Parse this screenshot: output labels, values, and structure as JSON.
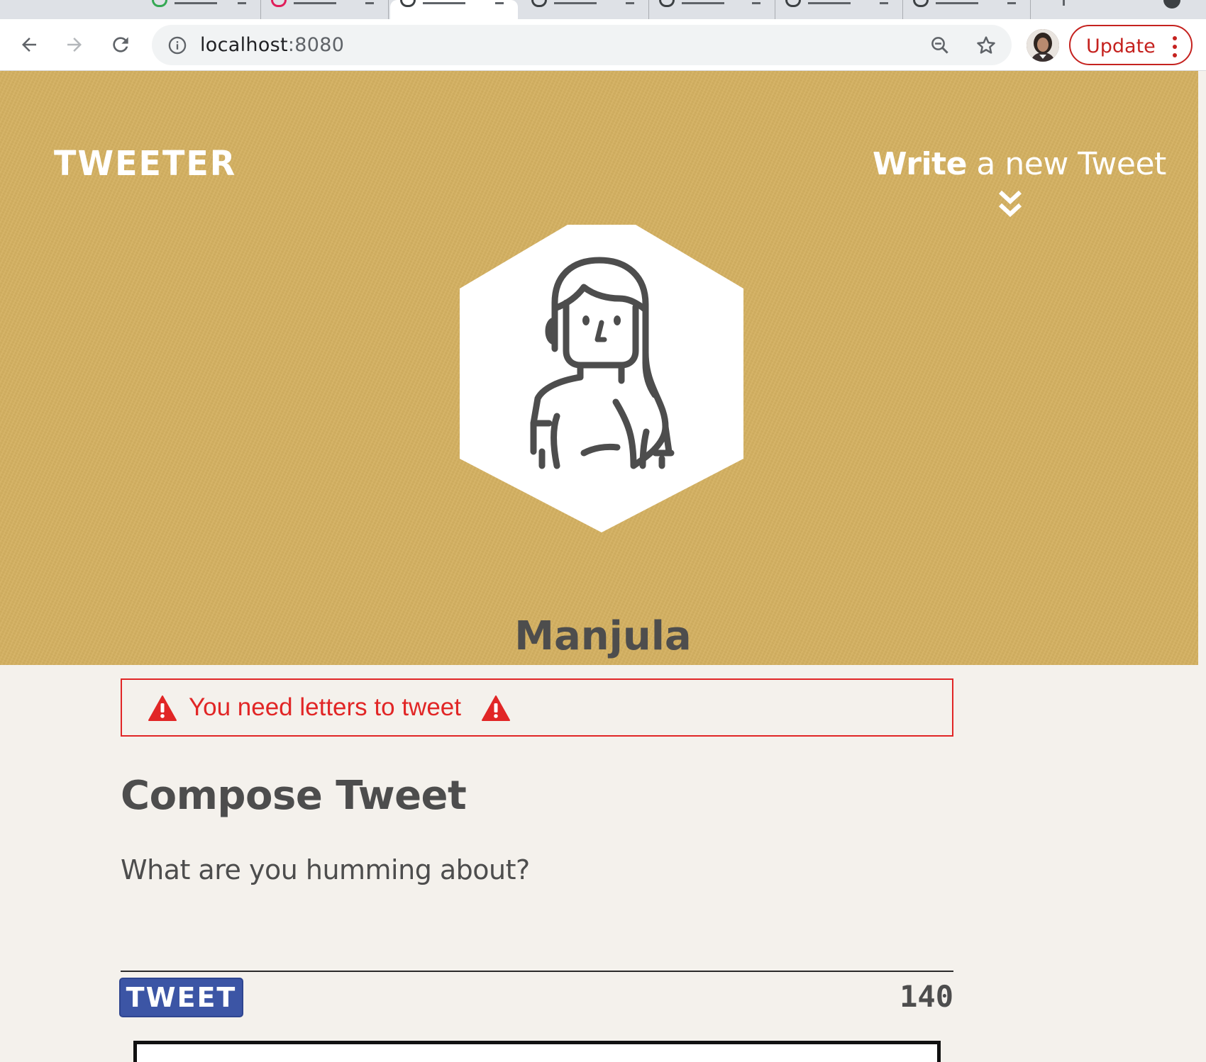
{
  "browser": {
    "url_host": "localhost",
    "url_port": ":8080",
    "update_label": "Update"
  },
  "header": {
    "brand": "TWEETER",
    "write_strong": "Write",
    "write_rest": " a new Tweet"
  },
  "profile": {
    "name": "Manjula"
  },
  "error": {
    "message": "You need letters to tweet"
  },
  "compose": {
    "title": "Compose Tweet",
    "placeholder": "What are you humming about?",
    "button_label": "TWEET",
    "counter": "140"
  },
  "colors": {
    "hero_bg": "#d4b060",
    "error": "#e12626",
    "button": "#3c55a5",
    "text": "#4d4d4d",
    "page_bg": "#f4f1ec"
  }
}
